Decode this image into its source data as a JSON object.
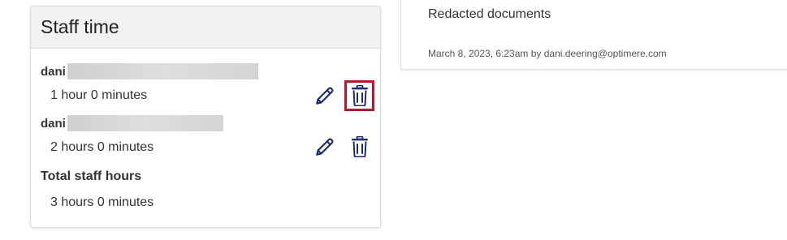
{
  "staff_card": {
    "title": "Staff time",
    "entries": [
      {
        "name": "dani",
        "duration": "1 hour 0 minutes"
      },
      {
        "name": "dani",
        "duration": "2 hours 0 minutes"
      }
    ],
    "total_label": "Total staff hours",
    "total_value": "3 hours 0 minutes"
  },
  "document": {
    "title": "Redacted documents",
    "meta": "March 8, 2023, 6:23am by dani.deering@optimere.com"
  },
  "icons": {
    "edit": "pencil-icon",
    "delete": "trash-icon"
  },
  "colors": {
    "icon": "#1f2d6b",
    "highlight": "#b01c2e",
    "header_bg": "#f2f2f2"
  }
}
